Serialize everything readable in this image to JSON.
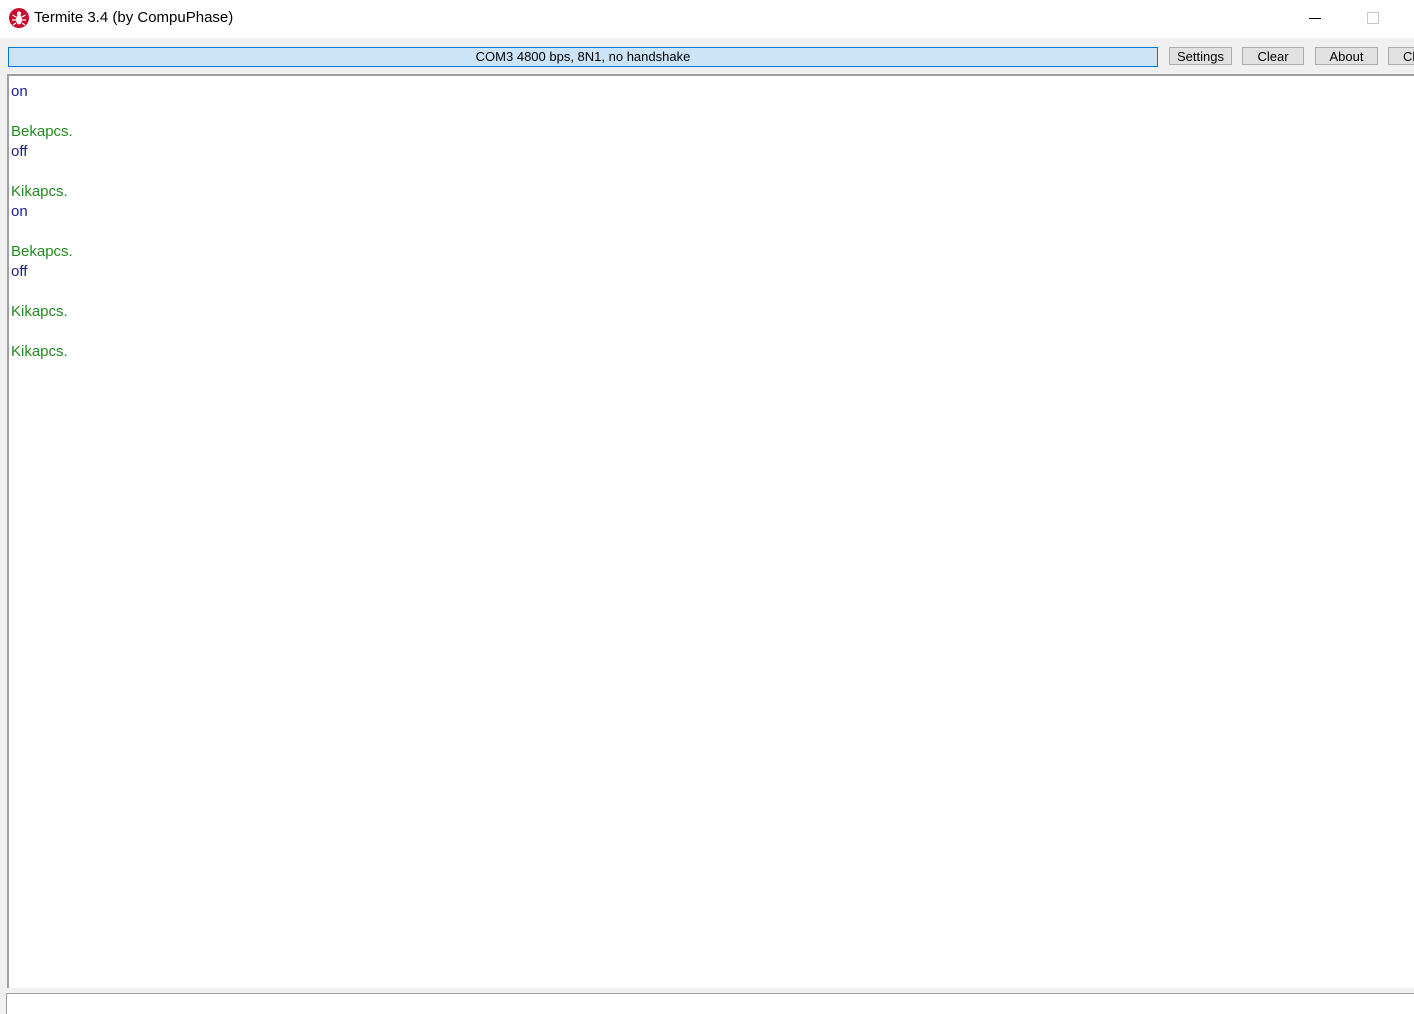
{
  "window": {
    "title": "Termite 3.4 (by CompuPhase)"
  },
  "toolbar": {
    "port_status": "COM3 4800 bps, 8N1, no handshake",
    "settings_label": "Settings",
    "clear_label": "Clear",
    "about_label": "About",
    "close_label": "Cl"
  },
  "output": {
    "lines": [
      {
        "text": "on",
        "kind": "tx"
      },
      {
        "text": "",
        "kind": "rx"
      },
      {
        "text": "Bekapcs.",
        "kind": "rx"
      },
      {
        "text": "off",
        "kind": "tx"
      },
      {
        "text": "",
        "kind": "rx"
      },
      {
        "text": "Kikapcs.",
        "kind": "rx"
      },
      {
        "text": "on",
        "kind": "tx"
      },
      {
        "text": "",
        "kind": "rx"
      },
      {
        "text": "Bekapcs.",
        "kind": "rx"
      },
      {
        "text": "off",
        "kind": "tx"
      },
      {
        "text": "",
        "kind": "rx"
      },
      {
        "text": "Kikapcs.",
        "kind": "rx"
      },
      {
        "text": "",
        "kind": "rx"
      },
      {
        "text": "Kikapcs.",
        "kind": "rx"
      }
    ]
  },
  "input": {
    "value": ""
  },
  "colors": {
    "received_text": "#228b22",
    "sent_text": "#1c1c9c",
    "status_bg": "#cce4f7",
    "status_border": "#0078d7"
  },
  "icons": {
    "app": "termite-bug-icon",
    "minimize": "minimize-icon",
    "maximize": "maximize-icon"
  }
}
